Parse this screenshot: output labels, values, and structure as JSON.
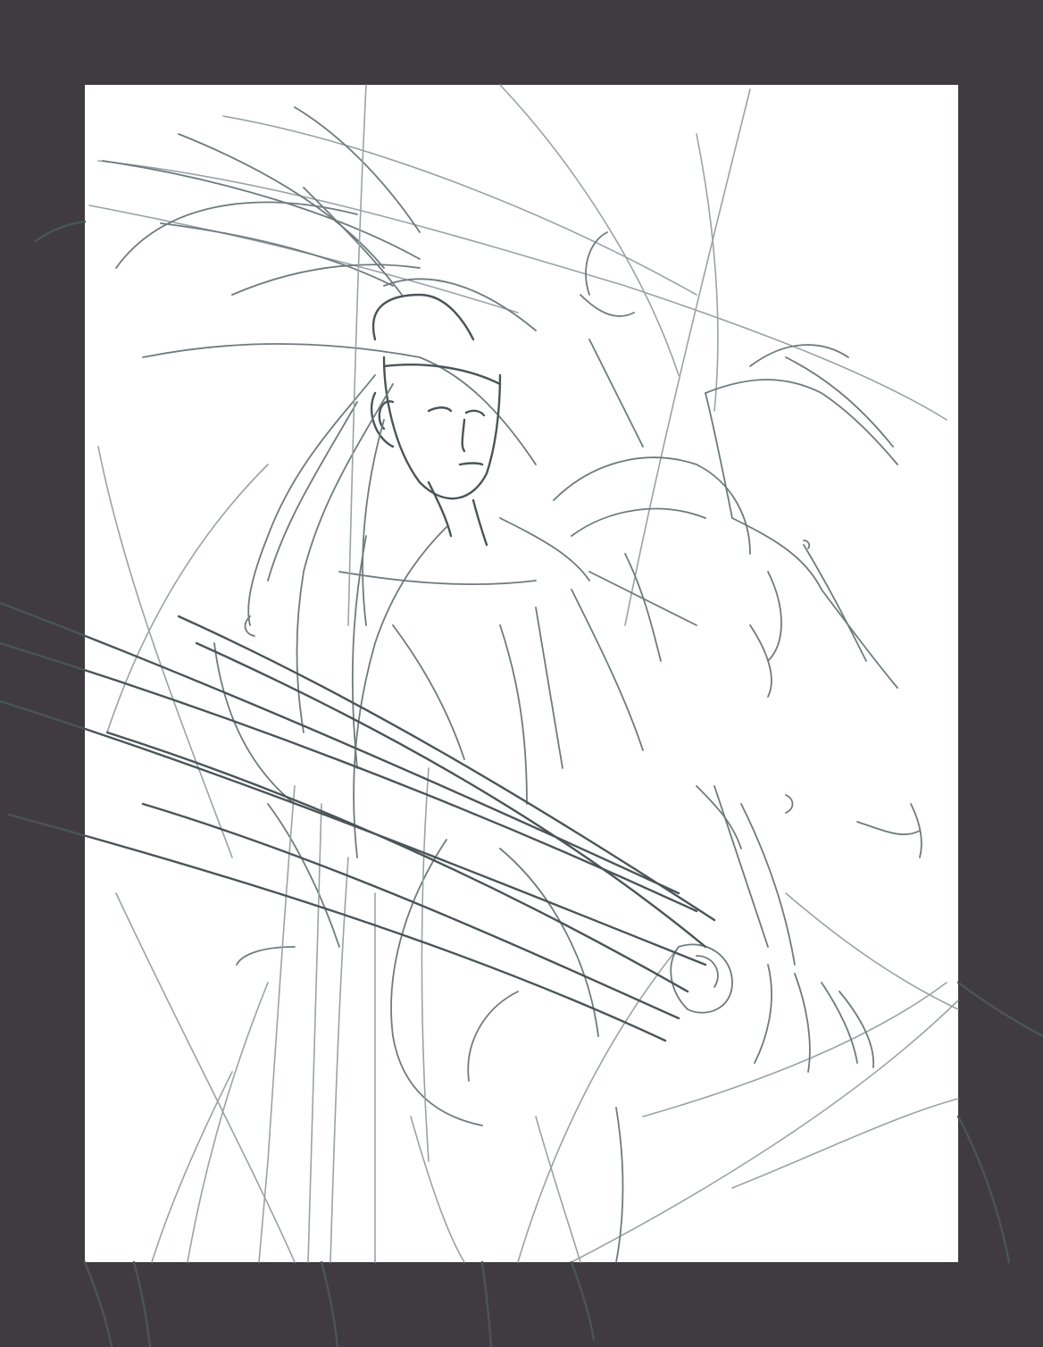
{
  "colors": {
    "background": "#403b41",
    "paper": "#ffffff",
    "stroke_light": "#9aa3a4",
    "stroke_mid": "#6f7b7d",
    "stroke_dark": "#4a5557"
  },
  "scene": {
    "subject": "pencil-sketch-of-figure-with-heron"
  }
}
